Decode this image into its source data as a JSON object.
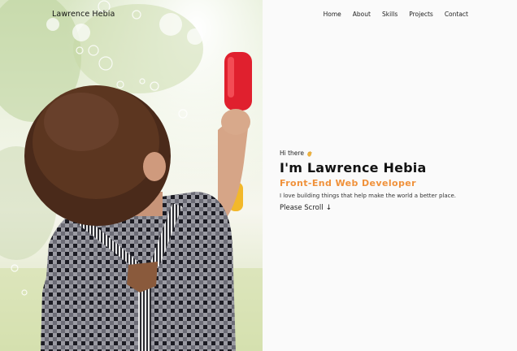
{
  "header": {
    "brand": "Lawrence Hebia",
    "nav": [
      {
        "label": "Home"
      },
      {
        "label": "About"
      },
      {
        "label": "Skills"
      },
      {
        "label": "Projects"
      },
      {
        "label": "Contact"
      }
    ]
  },
  "intro": {
    "greeting": "Hi there",
    "greeting_icon": "waving-hand-icon",
    "name": "I'm Lawrence Hebia",
    "role": "Front-End Web Developer",
    "tagline": "I love building things that help make the world a better place.",
    "scroll_label": "Please Scroll",
    "scroll_icon": "arrow-down-icon"
  },
  "colors": {
    "accent": "#f0913a",
    "text": "#111111",
    "background": "#fafafa"
  }
}
